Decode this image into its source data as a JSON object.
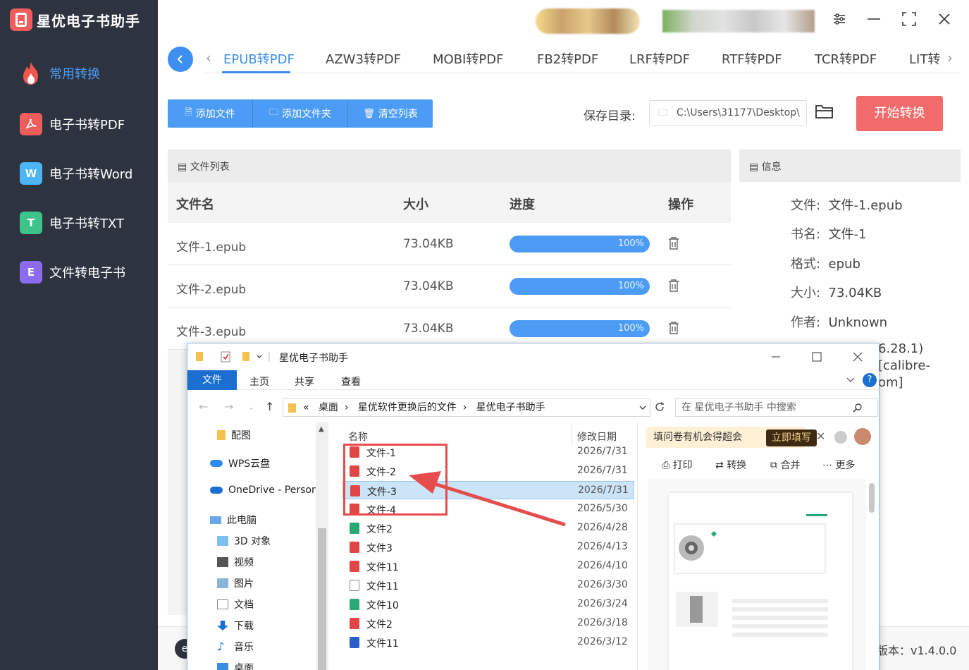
{
  "app": {
    "title": "星优电子书助手",
    "version": "版本：v1.4.0.0"
  },
  "sidebar": {
    "items": [
      {
        "label": "常用转换",
        "icon": "fire-icon",
        "color": "#ee5c5c"
      },
      {
        "label": "电子书转PDF",
        "icon": "pdf-icon",
        "color": "#ee5c5c"
      },
      {
        "label": "电子书转Word",
        "icon": "word-icon",
        "color": "#4cb5f5",
        "glyph": "W"
      },
      {
        "label": "电子书转TXT",
        "icon": "txt-icon",
        "color": "#3cc48a",
        "glyph": "T"
      },
      {
        "label": "文件转电子书",
        "icon": "ebook-icon",
        "color": "#8b6cf0",
        "glyph": "E"
      }
    ]
  },
  "tabs": [
    "EPUB转PDF",
    "AZW3转PDF",
    "MOBI转PDF",
    "FB2转PDF",
    "LRF转PDF",
    "RTF转PDF",
    "TCR转PDF",
    "LIT转"
  ],
  "toolbar": {
    "add_file": "添加文件",
    "add_folder": "添加文件夹",
    "clear_list": "清空列表",
    "save_label": "保存目录:",
    "save_path": "C:\\Users\\31177\\Desktop\\",
    "start": "开始转换"
  },
  "file_list": {
    "title": "文件列表",
    "columns": [
      "文件名",
      "大小",
      "进度",
      "操作"
    ],
    "rows": [
      {
        "name": "文件-1.epub",
        "size": "73.04KB",
        "progress": "100%"
      },
      {
        "name": "文件-2.epub",
        "size": "73.04KB",
        "progress": "100%"
      },
      {
        "name": "文件-3.epub",
        "size": "73.04KB",
        "progress": "100%"
      }
    ]
  },
  "info": {
    "title": "信息",
    "fields": [
      {
        "key": "文件:",
        "value": "文件-1.epub"
      },
      {
        "key": "书名:",
        "value": "文件-1"
      },
      {
        "key": "格式:",
        "value": "epub"
      },
      {
        "key": "大小:",
        "value": "73.04KB"
      },
      {
        "key": "作者:",
        "value": "Unknown"
      }
    ],
    "fragments": [
      "6.28.1)",
      "[calibre-",
      "om]"
    ]
  },
  "explorer": {
    "title": "星优电子书助手",
    "ribbon": [
      "文件",
      "主页",
      "共享",
      "查看"
    ],
    "address": [
      "«",
      "桌面",
      "星优软件更换后的文件",
      "星优电子书助手"
    ],
    "search_placeholder": "在 星优电子书助手 中搜索",
    "tree": [
      "配图",
      "WPS云盘",
      "OneDrive - Person",
      "此电脑",
      "3D 对象",
      "视频",
      "图片",
      "文档",
      "下载",
      "音乐",
      "桌面"
    ],
    "col_name": "名称",
    "col_date": "修改日期",
    "files": [
      {
        "name": "文件-1",
        "date": "2026/7/31",
        "type": "pdf"
      },
      {
        "name": "文件-2",
        "date": "2026/7/31",
        "type": "pdf"
      },
      {
        "name": "文件-3",
        "date": "2026/7/31",
        "type": "pdf"
      },
      {
        "name": "文件-4",
        "date": "2026/5/30",
        "type": "pdf"
      },
      {
        "name": "文件2",
        "date": "2026/4/28",
        "type": "epub"
      },
      {
        "name": "文件3",
        "date": "2026/4/13",
        "type": "pdf"
      },
      {
        "name": "文件11",
        "date": "2026/4/10",
        "type": "pdf"
      },
      {
        "name": "文件11",
        "date": "2026/3/30",
        "type": "txt"
      },
      {
        "name": "文件10",
        "date": "2026/3/24",
        "type": "epub"
      },
      {
        "name": "文件2",
        "date": "2026/3/18",
        "type": "pdf"
      },
      {
        "name": "文件11",
        "date": "2026/3/12",
        "type": "word"
      }
    ],
    "ad_text": "填问卷有机会得超会",
    "ad_button": "立即填写",
    "preview_tools": [
      "打印",
      "转换",
      "合并",
      "更多"
    ]
  },
  "colors": {
    "accent": "#4c9cf5",
    "start": "#f26b6b",
    "sidebar": "#2e3340",
    "highlight": "#e64c4c"
  }
}
